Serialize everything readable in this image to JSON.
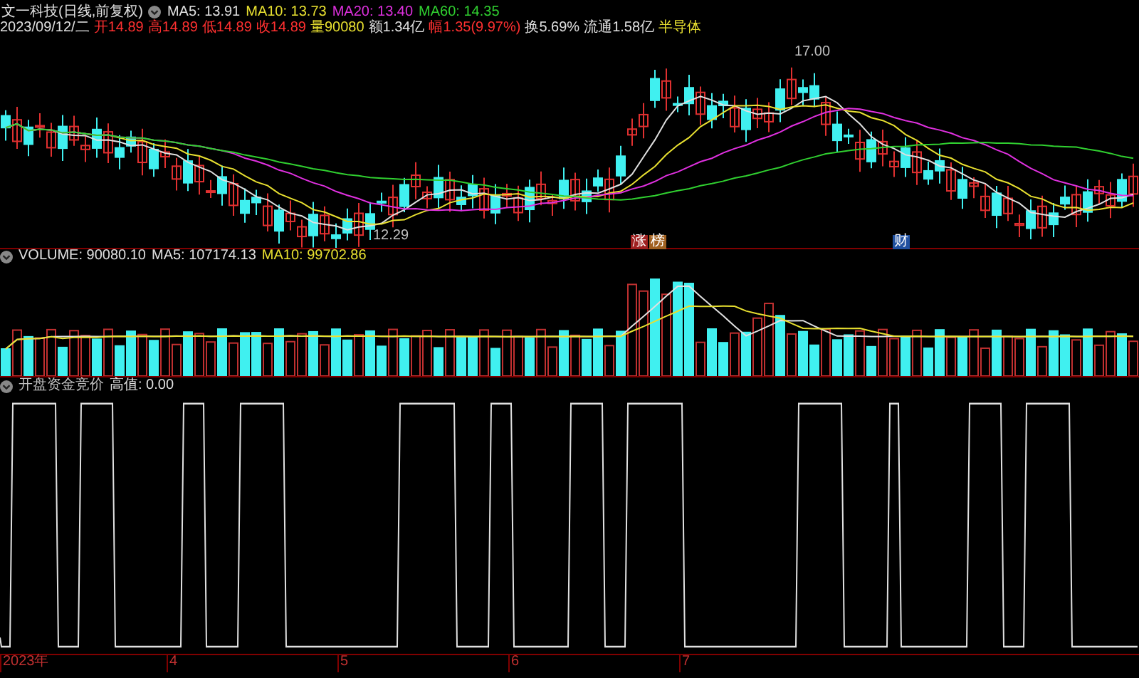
{
  "main_panel": {
    "title": "文一科技(日线,前复权)",
    "moving_averages": [
      {
        "label": "MA5: 13.91",
        "color": "#e0e0e0"
      },
      {
        "label": "MA10: 13.73",
        "color": "#e8e030"
      },
      {
        "label": "MA20: 13.40",
        "color": "#e030e0"
      },
      {
        "label": "MA60: 14.35",
        "color": "#30d030"
      }
    ],
    "quote": [
      {
        "text": "2023/09/12/二",
        "color": "#e0e0e0"
      },
      {
        "text": "开14.89",
        "color": "#ff3030"
      },
      {
        "text": "高14.89",
        "color": "#ff3030"
      },
      {
        "text": "低14.89",
        "color": "#ff3030"
      },
      {
        "text": "收14.89",
        "color": "#ff3030"
      },
      {
        "text": "量90080",
        "color": "#e8e030"
      },
      {
        "text": "额1.34亿",
        "color": "#e0e0e0"
      },
      {
        "text": "幅1.35(9.97%)",
        "color": "#ff3030"
      },
      {
        "text": "换5.69%",
        "color": "#e0e0e0"
      },
      {
        "text": "流通1.58亿",
        "color": "#e0e0e0"
      },
      {
        "text": "半导体",
        "color": "#e8e030"
      }
    ],
    "high_label": "17.00",
    "low_label": "12.29",
    "markers": [
      {
        "text": "涨",
        "color": "#a02020"
      },
      {
        "text": "榜",
        "color": "#a06020"
      },
      {
        "text": "财",
        "color": "#2050a0"
      }
    ]
  },
  "volume_panel": {
    "values": [
      {
        "label": "VOLUME: 90080.10",
        "color": "#e0e0e0"
      },
      {
        "label": "MA5: 107174.13",
        "color": "#e0e0e0"
      },
      {
        "label": "MA10: 99702.86",
        "color": "#e8e030"
      }
    ]
  },
  "indicator_panel": {
    "name": "开盘资金竞价",
    "value": "高值: 0.00"
  },
  "x_axis": [
    "2023年",
    "4",
    "5",
    "6",
    "7"
  ]
}
